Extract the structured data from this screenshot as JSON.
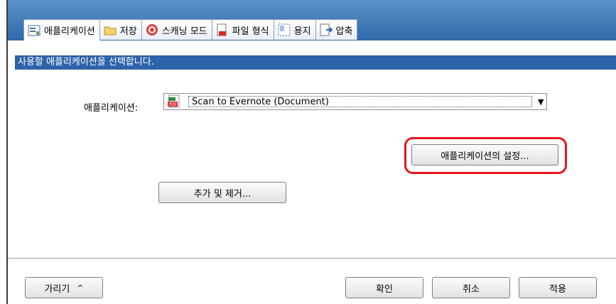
{
  "tabs": [
    {
      "label": "애플리케이션",
      "icon": "application-tab-icon",
      "active": true
    },
    {
      "label": "저장",
      "icon": "folder-icon",
      "active": false
    },
    {
      "label": "스캐닝 모드",
      "icon": "scan-mode-icon",
      "active": false
    },
    {
      "label": "파일 형식",
      "icon": "file-format-icon",
      "active": false
    },
    {
      "label": "용지",
      "icon": "paper-icon",
      "active": false
    },
    {
      "label": "압축",
      "icon": "compression-icon",
      "active": false
    }
  ],
  "main": {
    "instruction": "사용할 애플리케이션을 선택합니다.",
    "application_label": "애플리케이션:",
    "application_value": "Scan to Evernote (Document)",
    "settings_button": "애플리케이션의 설정...",
    "add_remove_button": "추가 및 제거..."
  },
  "footer": {
    "hide_button": "가리기",
    "ok_button": "확인",
    "cancel_button": "취소",
    "apply_button": "적용"
  },
  "colors": {
    "header_blue": "#2f69a8",
    "instruction_bar": "#2d63a9",
    "highlight_red": "#e5161d"
  }
}
